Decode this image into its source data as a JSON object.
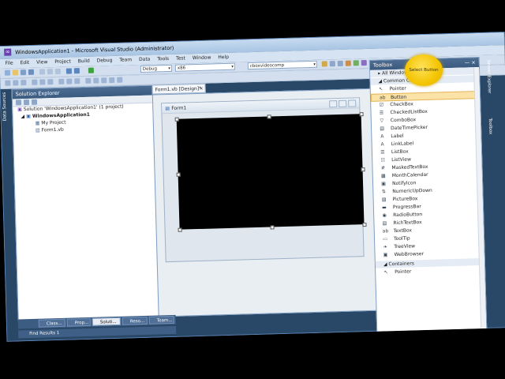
{
  "window": {
    "title": "WindowsApplication1 - Microsoft Visual Studio (Administrator)"
  },
  "menu": [
    "File",
    "Edit",
    "View",
    "Project",
    "Build",
    "Debug",
    "Team",
    "Data",
    "Tools",
    "Test",
    "Window",
    "Help"
  ],
  "toolbar": {
    "config": "Debug",
    "platform": "x86",
    "search_combo": "cboxvideocomp"
  },
  "solution_explorer": {
    "title": "Solution Explorer",
    "pin": "— ×",
    "solution": "Solution 'WindowsApplication1' (1 project)",
    "project": "WindowsApplication1",
    "items": [
      "My Project",
      "Form1.vb"
    ]
  },
  "document": {
    "tab": "Form1.vb [Design]*",
    "tab_close": "×",
    "form_title": "Form1"
  },
  "toolbox": {
    "title": "Toolbox",
    "header_all": "All Windows Fo",
    "common_header": "Common Controls",
    "items": [
      {
        "label": "Pointer",
        "icon": "↖"
      },
      {
        "label": "Button",
        "icon": "ab"
      },
      {
        "label": "CheckBox",
        "icon": "☑"
      },
      {
        "label": "CheckedListBox",
        "icon": "☰"
      },
      {
        "label": "ComboBox",
        "icon": "▽"
      },
      {
        "label": "DateTimePicker",
        "icon": "▤"
      },
      {
        "label": "Label",
        "icon": "A"
      },
      {
        "label": "LinkLabel",
        "icon": "A"
      },
      {
        "label": "ListBox",
        "icon": "☰"
      },
      {
        "label": "ListView",
        "icon": "☷"
      },
      {
        "label": "MaskedTextBox",
        "icon": "#"
      },
      {
        "label": "MonthCalendar",
        "icon": "▦"
      },
      {
        "label": "NotifyIcon",
        "icon": "▣"
      },
      {
        "label": "NumericUpDown",
        "icon": "⇅"
      },
      {
        "label": "PictureBox",
        "icon": "▧"
      },
      {
        "label": "ProgressBar",
        "icon": "▬"
      },
      {
        "label": "RadioButton",
        "icon": "◉"
      },
      {
        "label": "RichTextBox",
        "icon": "▤"
      },
      {
        "label": "TextBox",
        "icon": "ab"
      },
      {
        "label": "ToolTip",
        "icon": "▭"
      },
      {
        "label": "TreeView",
        "icon": "❧"
      },
      {
        "label": "WebBrowser",
        "icon": "▣"
      }
    ],
    "containers_header": "Containers",
    "container_items": [
      {
        "label": "Pointer",
        "icon": "↖"
      }
    ]
  },
  "side_tabs": [
    "Server Explorer",
    "Toolbox"
  ],
  "left_side_tab": "Data Sources",
  "bottom_tabs": [
    "Class...",
    "Prop...",
    "Soluti...",
    "Reso...",
    "Team..."
  ],
  "find_results": "Find Results 1",
  "callout": "Select Button",
  "colors": {
    "frame": "#294766",
    "panel_title": "#4d6c92",
    "selection": "#fbe2a7",
    "callout": "#f4c400"
  }
}
